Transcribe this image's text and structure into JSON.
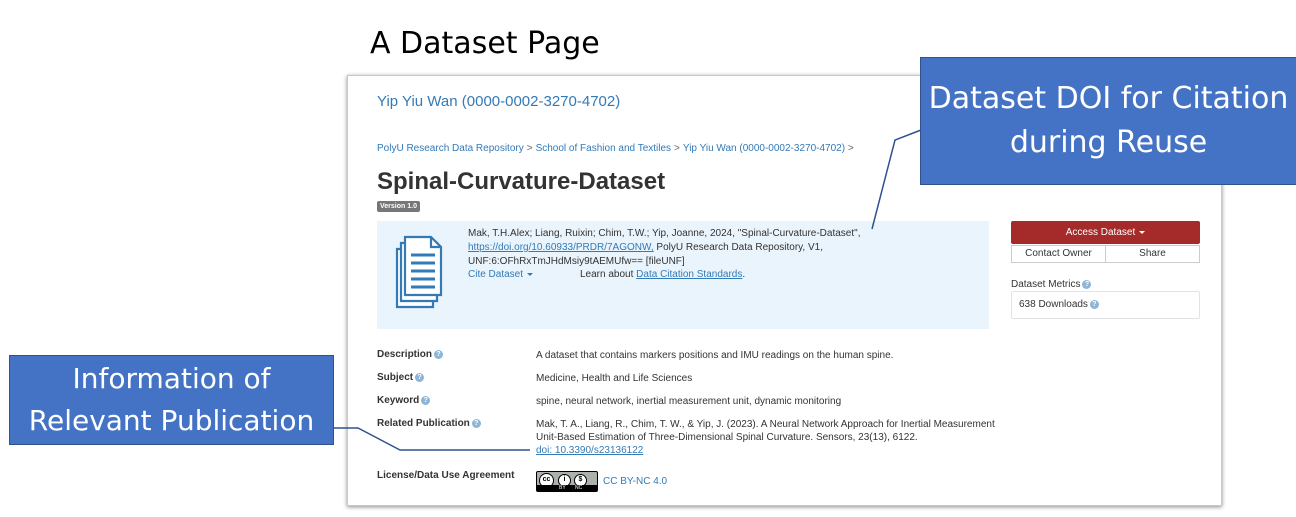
{
  "slide_title": "A Dataset Page",
  "page": {
    "owner_link": "Yip Yiu Wan (0000-0002-3270-4702)",
    "breadcrumb": [
      "PolyU Research Data Repository",
      "School of Fashion and Textiles",
      "Yip Yiu Wan (0000-0002-3270-4702)"
    ],
    "breadcrumb_separator": ">",
    "dataset_title": "Spinal-Curvature-Dataset",
    "version_badge": "Version 1.0",
    "citation": {
      "text_before_link": "Mak, T.H.Alex; Liang, Ruixin; Chim, T.W.; Yip, Joanne, 2024, \"Spinal-Curvature-Dataset\", ",
      "doi_link": "https://doi.org/10.60933/PRDR/7AGONW,",
      "text_after_link": " PolyU Research Data Repository, V1, UNF:6:OFhRxTmJHdMsiy9tAEMUfw== [fileUNF]",
      "cite_button": "Cite Dataset",
      "learn_prefix": "Learn about ",
      "learn_link": "Data Citation Standards",
      "learn_suffix": "."
    },
    "actions": {
      "access_dataset": "Access Dataset",
      "contact_owner": "Contact Owner",
      "share": "Share"
    },
    "metrics": {
      "label": "Dataset Metrics",
      "downloads": "638 Downloads"
    },
    "metadata": {
      "description_label": "Description",
      "description_value": "A dataset that contains markers positions and IMU readings on the human spine.",
      "subject_label": "Subject",
      "subject_value": "Medicine, Health and Life Sciences",
      "keyword_label": "Keyword",
      "keyword_value": "spine, neural network, inertial measurement unit, dynamic monitoring",
      "publication_label": "Related Publication",
      "publication_value": "Mak, T. A., Liang, R., Chim, T. W., & Yip, J. (2023). A Neural Network Approach for Inertial Measurement Unit-Based Estimation of Three-Dimensional Spinal Curvature. Sensors, 23(13), 6122.",
      "publication_doi": "doi: 10.3390/s23136122",
      "license_label": "License/Data Use Agreement",
      "license_link": "CC BY-NC 4.0",
      "license_badge_cc": "cc",
      "license_badge_by": "BY",
      "license_badge_nc": "NC"
    },
    "help_icon": "?"
  },
  "callouts": {
    "doi": "Dataset DOI for Citation during Reuse",
    "publication": "Information of Relevant Publication"
  },
  "colors": {
    "link": "#337ab7",
    "access_button": "#a52a2a",
    "citation_bg": "#eaf4fc",
    "callout_fill": "#4472c4"
  },
  "icons": {
    "document": "document-stack-icon",
    "help": "question-circle-icon"
  }
}
